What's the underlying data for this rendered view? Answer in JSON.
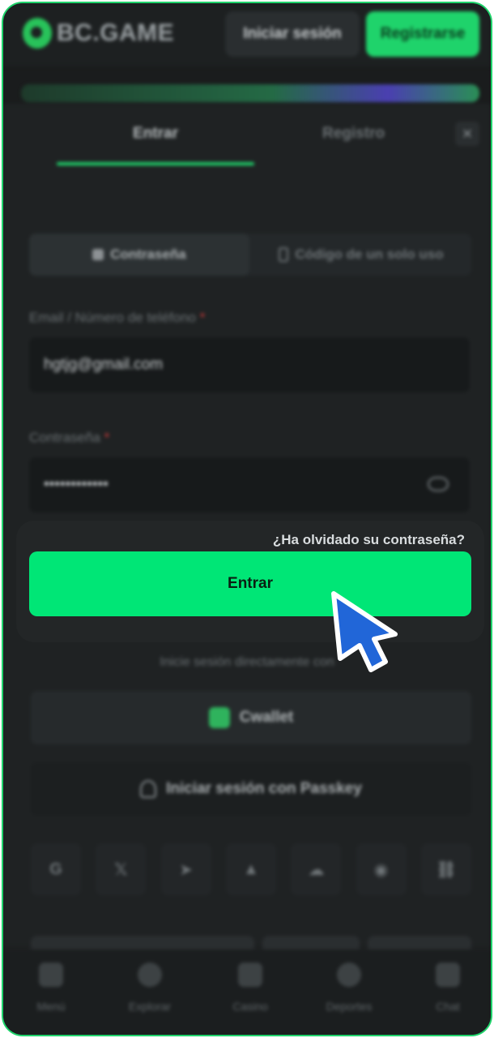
{
  "header": {
    "logo_text": "BC.GAME",
    "login_button": "Iniciar sesión",
    "register_button": "Registrarse"
  },
  "modal": {
    "tabs": [
      {
        "label": "Entrar",
        "active": true
      },
      {
        "label": "Registro",
        "active": false
      }
    ],
    "close_icon": "×",
    "methods": [
      {
        "label": "Contraseña",
        "active": true,
        "icon": "lock-icon"
      },
      {
        "label": "Código de un solo uso",
        "active": false,
        "icon": "phone-icon"
      }
    ],
    "email_field": {
      "label": "Email / Número de teléfono",
      "required_mark": "*",
      "value": "hgtjg@gmail.com"
    },
    "password_field": {
      "label": "Contraseña",
      "required_mark": "*",
      "value": "••••••••••••",
      "toggle_icon": "eye-icon"
    },
    "forgot_password": "¿Ha olvidado su contraseña?",
    "submit_label": "Entrar",
    "alt_login_text": "Inicie sesión directamente con",
    "wallet_button": "Cwallet",
    "passkey_button": "Iniciar sesión con Passkey",
    "social_icons": [
      "google-icon",
      "x-icon",
      "telegram-icon",
      "metamask-icon",
      "cloud-icon",
      "line-icon",
      "link-icon"
    ],
    "social_glyphs": [
      "G",
      "𝕏",
      "➤",
      "▲",
      "☁",
      "◉",
      "⛓"
    ]
  },
  "bottom_nav": [
    {
      "label": "Menú",
      "icon": "menu-icon"
    },
    {
      "label": "Explorar",
      "icon": "search-icon"
    },
    {
      "label": "Casino",
      "icon": "casino-icon"
    },
    {
      "label": "Deportes",
      "icon": "sports-icon"
    },
    {
      "label": "Chat",
      "icon": "chat-icon"
    }
  ],
  "colors": {
    "accent": "#00e676",
    "brand_green": "#1fd36b",
    "background": "#1a1c1d",
    "cursor": "#2166d8"
  }
}
